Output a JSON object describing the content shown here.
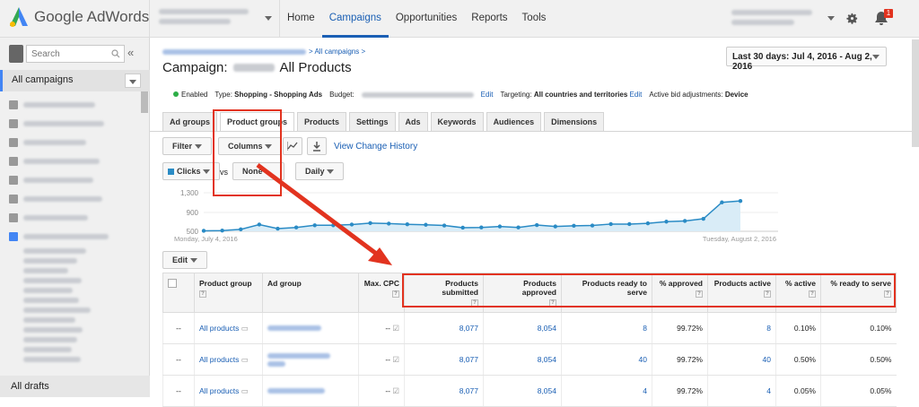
{
  "topbar": {
    "brand": "Google AdWords",
    "nav": [
      "Home",
      "Campaigns",
      "Opportunities",
      "Reports",
      "Tools"
    ],
    "active_nav": "Campaigns",
    "notification_badge": "1"
  },
  "sidebar": {
    "search_placeholder": "Search",
    "collapse_glyph": "«",
    "all_campaigns": "All campaigns",
    "all_drafts": "All drafts"
  },
  "header": {
    "breadcrumb_suffix": "> All campaigns >",
    "title_prefix": "Campaign:",
    "title_suffix": "All Products",
    "date_range": "Last 30 days: Jul 4, 2016 - Aug 2, 2016"
  },
  "status": {
    "enabled": "Enabled",
    "type_label": "Type:",
    "type_value": "Shopping - Shopping Ads",
    "budget_label": "Budget:",
    "edit1": "Edit",
    "targeting_label": "Targeting:",
    "targeting_value": "All countries and territories",
    "edit2": "Edit",
    "adjust_label": "Active bid adjustments:",
    "adjust_value": "Device"
  },
  "tabs": [
    "Ad groups",
    "Product groups",
    "Products",
    "Settings",
    "Ads",
    "Keywords",
    "Audiences",
    "Dimensions"
  ],
  "active_tab": "Product groups",
  "toolbar": {
    "filter": "Filter",
    "columns": "Columns",
    "view_history": "View Change History",
    "metric1": "Clicks",
    "vs": "vs",
    "metric2": "None",
    "period": "Daily",
    "edit": "Edit"
  },
  "chart_data": {
    "type": "area",
    "title": "",
    "xlabel": "",
    "ylabel": "",
    "x_start_label": "Monday, July 4, 2016",
    "x_end_label": "Tuesday, August 2, 2016",
    "yticks": [
      "1,300",
      "900",
      "500"
    ],
    "ylim": [
      500,
      1300
    ],
    "series": [
      {
        "name": "Clicks",
        "values": [
          510,
          515,
          540,
          640,
          555,
          580,
          625,
          625,
          640,
          670,
          660,
          645,
          635,
          620,
          575,
          580,
          600,
          580,
          630,
          600,
          615,
          620,
          650,
          650,
          665,
          700,
          715,
          760,
          1100,
          1130
        ]
      }
    ],
    "color": "#2a8bc5",
    "fill": "#d9ecf7"
  },
  "table": {
    "headers": [
      "Product group",
      "Ad group",
      "Max. CPC",
      "Products submitted",
      "Products approved",
      "Products ready to serve",
      "% approved",
      "Products active",
      "% active",
      "% ready to serve"
    ],
    "help_glyph": "?",
    "rows": [
      {
        "dash": "--",
        "product_group": "All products",
        "cpc": "--",
        "submitted": "8,077",
        "approved": "8,054",
        "ready": "8",
        "pct_approved": "99.72%",
        "active": "8",
        "pct_active": "0.10%",
        "pct_ready": "0.10%"
      },
      {
        "dash": "--",
        "product_group": "All products",
        "cpc": "--",
        "submitted": "8,077",
        "approved": "8,054",
        "ready": "40",
        "pct_approved": "99.72%",
        "active": "40",
        "pct_active": "0.50%",
        "pct_ready": "0.50%"
      },
      {
        "dash": "--",
        "product_group": "All products",
        "cpc": "--",
        "submitted": "8,077",
        "approved": "8,054",
        "ready": "4",
        "pct_approved": "99.72%",
        "active": "4",
        "pct_active": "0.05%",
        "pct_ready": "0.05%"
      }
    ]
  },
  "colors": {
    "accent": "#1a5fb4",
    "highlight": "#e2331f",
    "enabled": "#2dae47",
    "badge": "#e2331f"
  }
}
